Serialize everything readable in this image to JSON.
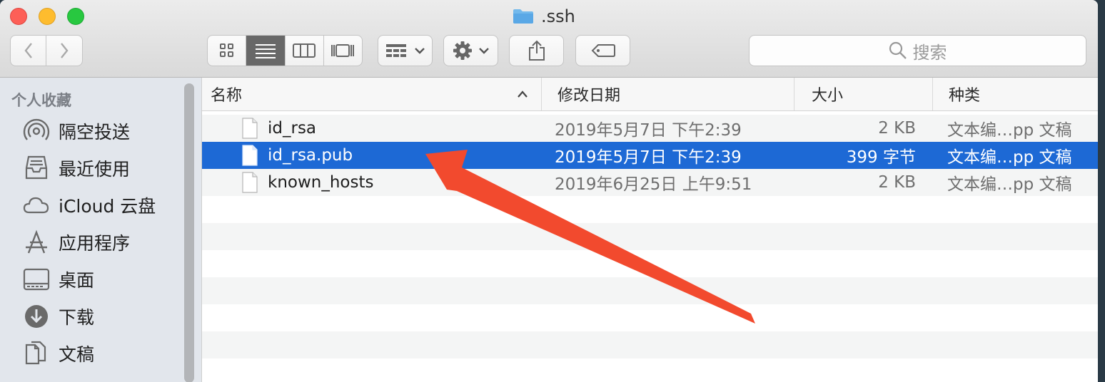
{
  "window": {
    "title": ".ssh"
  },
  "toolbar": {
    "back_icon": "chevron-left-icon",
    "forward_icon": "chevron-right-icon",
    "view_modes": [
      "icon-view-icon",
      "list-view-icon",
      "column-view-icon",
      "gallery-view-icon"
    ],
    "active_view": "list-view-icon",
    "group_icon": "group-icon",
    "action_icon": "gear-icon",
    "share_icon": "share-icon",
    "tag_icon": "tag-icon",
    "search_placeholder": "搜索"
  },
  "sidebar": {
    "header": "个人收藏",
    "items": [
      {
        "label": "隔空投送",
        "icon": "airdrop-icon"
      },
      {
        "label": "最近使用",
        "icon": "recents-icon"
      },
      {
        "label": "iCloud 云盘",
        "icon": "cloud-icon"
      },
      {
        "label": "应用程序",
        "icon": "applications-icon"
      },
      {
        "label": "桌面",
        "icon": "desktop-icon"
      },
      {
        "label": "下载",
        "icon": "download-icon"
      },
      {
        "label": "文稿",
        "icon": "documents-icon"
      }
    ]
  },
  "columns": {
    "name": "名称",
    "date": "修改日期",
    "size": "大小",
    "kind": "种类"
  },
  "files": [
    {
      "name": "id_rsa",
      "date": "2019年5月7日 下午2:39",
      "size": "2 KB",
      "kind": "文本编…pp 文稿",
      "selected": false
    },
    {
      "name": "id_rsa.pub",
      "date": "2019年5月7日 下午2:39",
      "size": "399 字节",
      "kind": "文本编…pp 文稿",
      "selected": true
    },
    {
      "name": "known_hosts",
      "date": "2019年6月25日 上午9:51",
      "size": "2 KB",
      "kind": "文本编…pp 文稿",
      "selected": false
    }
  ],
  "colors": {
    "selection": "#1d69d5",
    "annotation_arrow": "#f24a2e"
  }
}
